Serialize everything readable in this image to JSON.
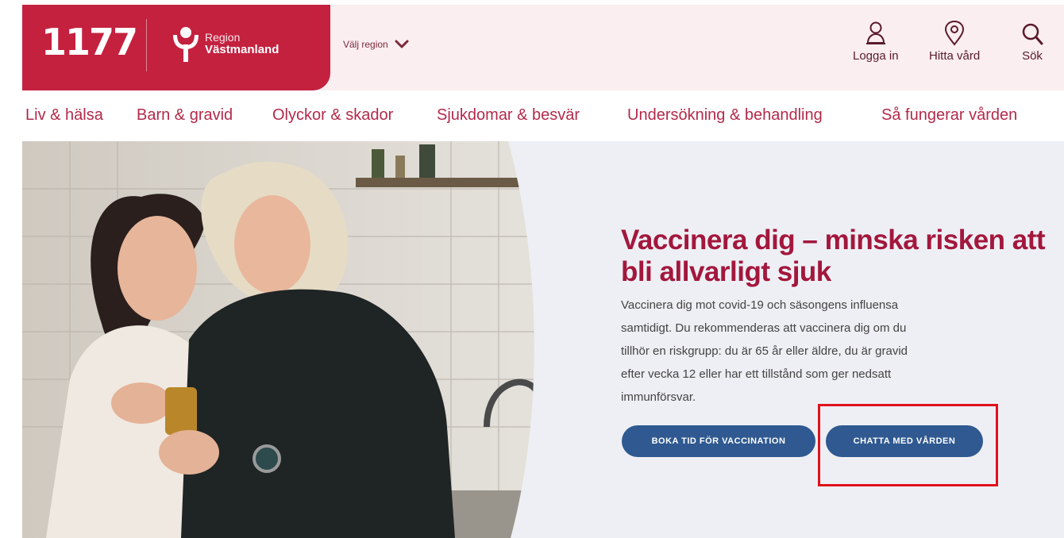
{
  "header": {
    "logo": "1177",
    "region_prefix": "Region",
    "region_name": "Västmanland",
    "region_selector": "Välj region",
    "tools": [
      {
        "label": "Logga in",
        "icon": "user-icon"
      },
      {
        "label": "Hitta vård",
        "icon": "location-pin-icon"
      },
      {
        "label": "Sök",
        "icon": "search-icon"
      }
    ]
  },
  "nav": {
    "items": [
      "Liv & hälsa",
      "Barn & gravid",
      "Olyckor & skador",
      "Sjukdomar & besvär",
      "Undersökning & behandling",
      "Så fungerar vården"
    ]
  },
  "hero": {
    "title": "Vaccinera dig – minska risken att bli allvarligt sjuk",
    "body_lines": [
      "Vaccinera dig mot covid-19 och säsongens influensa",
      "samtidigt. Du rekommenderas att vaccinera dig om du",
      "tillhör en riskgrupp: du är 65 år eller äldre, du är gravid",
      "efter vecka 12 eller har ett tillstånd som ger nedsatt",
      "immunförsvar."
    ],
    "buttons": {
      "book": "Boka tid för vaccination",
      "chat": "Chatta med vården"
    }
  },
  "colors": {
    "brand": "#c4213f",
    "header_bg": "#fbeef0",
    "nav_text": "#b32a4a",
    "title": "#a3173d",
    "button": "#2f5990",
    "highlight": "#e0111b"
  }
}
